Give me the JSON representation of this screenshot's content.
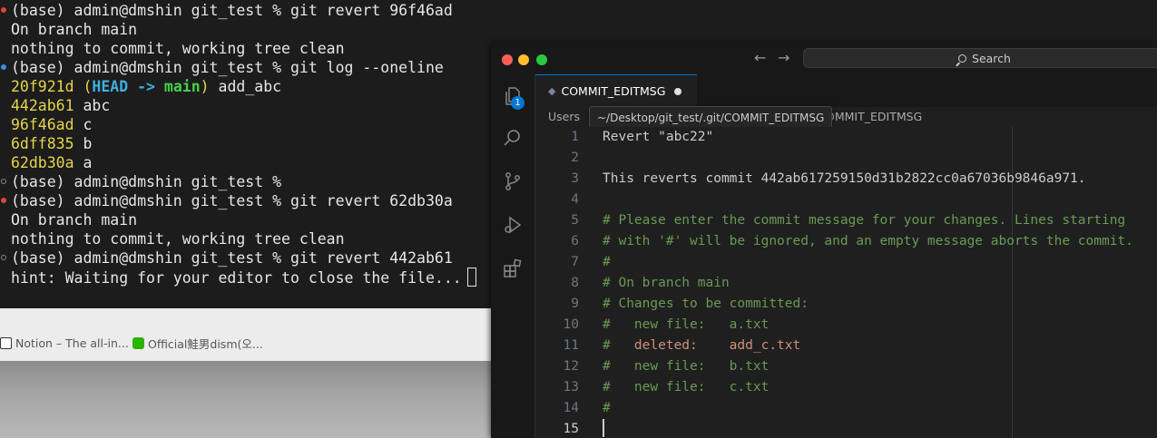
{
  "terminal": {
    "lines": [
      {
        "marker": "error",
        "text": "(base) admin@dmshin git_test % git revert 96f46ad"
      },
      {
        "marker": "none",
        "text": "On branch main"
      },
      {
        "marker": "none",
        "text": "nothing to commit, working tree clean"
      },
      {
        "marker": "success",
        "text": "(base) admin@dmshin git_test % git log --oneline"
      },
      {
        "marker": "none",
        "hash": "20f921d",
        "open_paren": " (",
        "head": "HEAD -> ",
        "branch": "main",
        "close_paren": ")",
        "msg": " add_abc"
      },
      {
        "marker": "none",
        "hash": "442ab61",
        "msg": " abc"
      },
      {
        "marker": "none",
        "hash": "96f46ad",
        "msg": " c"
      },
      {
        "marker": "none",
        "hash": "6dff835",
        "msg": " b"
      },
      {
        "marker": "none",
        "hash": "62db30a",
        "msg": " a"
      },
      {
        "marker": "idle",
        "text": "(base) admin@dmshin git_test %"
      },
      {
        "marker": "error",
        "text": "(base) admin@dmshin git_test % git revert 62db30a"
      },
      {
        "marker": "none",
        "text": "On branch main"
      },
      {
        "marker": "none",
        "text": "nothing to commit, working tree clean"
      },
      {
        "marker": "idle",
        "text": "(base) admin@dmshin git_test % git revert 442ab61"
      },
      {
        "marker": "none",
        "text": "hint: Waiting for your editor to close the file..."
      }
    ]
  },
  "browser": {
    "tabs": [
      {
        "icon": "notion-icon",
        "label": "Notion – The all-in..."
      },
      {
        "icon": "naver-blog-icon",
        "label": "Official鮭男dism(오..."
      }
    ]
  },
  "vscode": {
    "search_label": "Search",
    "tab": {
      "label": "COMMIT_EDITMSG",
      "modified": true
    },
    "badge_count": "1",
    "breadcrumb": {
      "first": "Users",
      "tail": "OMMIT_EDITMSG"
    },
    "tooltip": "~/Desktop/git_test/.git/COMMIT_EDITMSG",
    "current_line": 15,
    "lines": [
      {
        "n": "1",
        "text": "Revert \"abc22\"",
        "kind": "plain"
      },
      {
        "n": "2",
        "text": "",
        "kind": "plain"
      },
      {
        "n": "3",
        "text": "This reverts commit 442ab617259150d31b2822cc0a67036b9846a971.",
        "kind": "plain"
      },
      {
        "n": "4",
        "text": "",
        "kind": "plain"
      },
      {
        "n": "5",
        "text": "# Please enter the commit message for your changes. Lines starting",
        "kind": "comment"
      },
      {
        "n": "6",
        "text": "# with '#' will be ignored, and an empty message aborts the commit.",
        "kind": "comment"
      },
      {
        "n": "7",
        "text": "#",
        "kind": "comment"
      },
      {
        "n": "8",
        "text": "# On branch main",
        "kind": "comment"
      },
      {
        "n": "9",
        "text": "# Changes to be committed:",
        "kind": "comment"
      },
      {
        "n": "10",
        "prefix": "#   ",
        "text": "new file:   a.txt",
        "kind": "change"
      },
      {
        "n": "11",
        "prefix": "#   ",
        "text": "deleted:    add_c.txt",
        "kind": "deleted"
      },
      {
        "n": "12",
        "prefix": "#   ",
        "text": "new file:   b.txt",
        "kind": "change"
      },
      {
        "n": "13",
        "prefix": "#   ",
        "text": "new file:   c.txt",
        "kind": "change"
      },
      {
        "n": "14",
        "text": "#",
        "kind": "comment"
      },
      {
        "n": "15",
        "text": "",
        "kind": "plain"
      }
    ]
  },
  "colors": {
    "terminal_bg": "#1c1c1c",
    "hash_yellow": "#e5d54a",
    "head_cyan": "#3fb0e0",
    "branch_green": "#45d04a",
    "comment_green": "#6a9955",
    "deleted_orange": "#ce9178",
    "accent_blue": "#0078d4"
  }
}
